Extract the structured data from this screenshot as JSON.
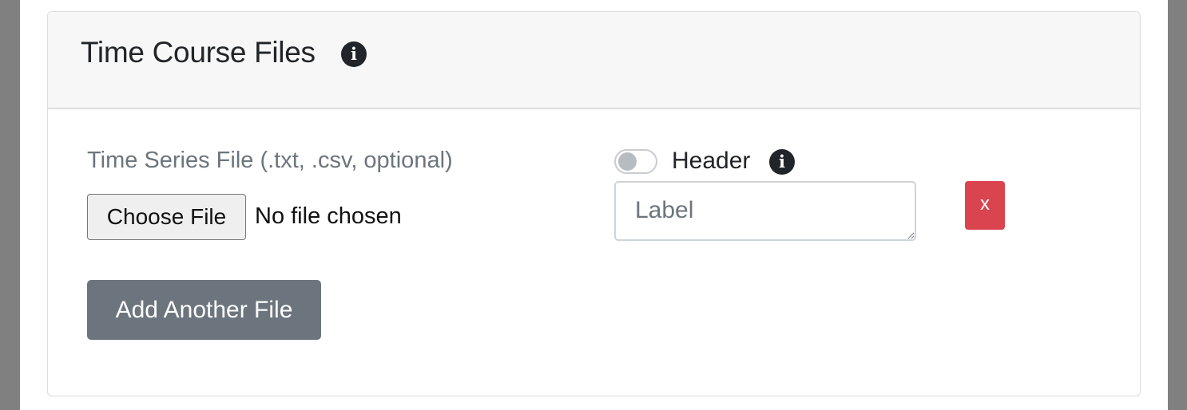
{
  "panel": {
    "title": "Time Course Files",
    "title_info_icon": "info-icon"
  },
  "file_entry": {
    "file_label": "Time Series File (.txt, .csv, optional)",
    "choose_button": "Choose File",
    "no_file_text": "No file chosen",
    "header_toggle": {
      "label": "Header",
      "checked": false,
      "info_icon": "info-icon"
    },
    "label_input": {
      "value": "",
      "placeholder": "Label"
    },
    "remove_button": "x"
  },
  "add_button": "Add Another File",
  "colors": {
    "remove": "#d9444f",
    "secondary": "#6c757d",
    "header_bg": "#f7f7f7"
  }
}
